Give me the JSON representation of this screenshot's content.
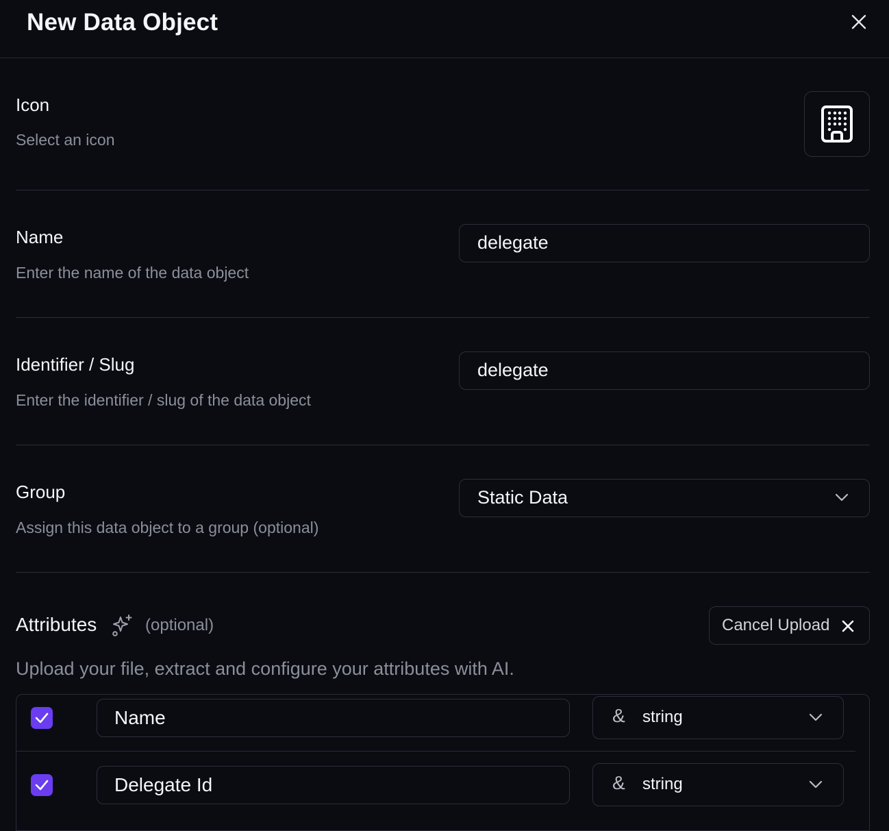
{
  "header": {
    "title": "New Data Object"
  },
  "icon_section": {
    "label": "Icon",
    "description": "Select an icon",
    "selected_icon": "building-icon"
  },
  "name_section": {
    "label": "Name",
    "description": "Enter the name of the data object",
    "value": "delegate"
  },
  "slug_section": {
    "label": "Identifier / Slug",
    "description": "Enter the identifier / slug of the data object",
    "value": "delegate"
  },
  "group_section": {
    "label": "Group",
    "description": "Assign this data object to a group (optional)",
    "value": "Static Data"
  },
  "attributes": {
    "title": "Attributes",
    "optional": "(optional)",
    "cancel_label": "Cancel Upload",
    "description": "Upload your file, extract and configure your attributes with AI.",
    "rows": [
      {
        "checked": true,
        "name": "Name",
        "type_symbol": "&",
        "type": "string"
      },
      {
        "checked": true,
        "name": "Delegate Id",
        "type_symbol": "&",
        "type": "string"
      }
    ]
  },
  "colors": {
    "accent": "#6a3df0",
    "background": "#0a0c12",
    "border": "#2c2f3a",
    "muted_text": "#8b8f9a"
  }
}
